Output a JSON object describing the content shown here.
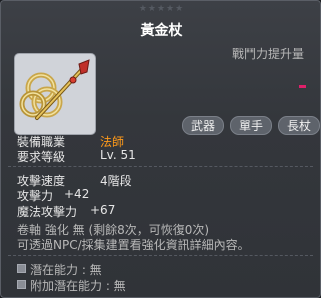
{
  "item": {
    "stars": "★★★★★",
    "name": "黃金杖",
    "power_label": "戰鬥力提升量",
    "tags": [
      "武器",
      "單手",
      "長杖"
    ],
    "job_label": "裝備職業",
    "job_value": "法師",
    "level_label": "要求等級",
    "level_value": "Lv. 51",
    "speed_label": "攻擊速度",
    "speed_value": "4階段",
    "attack_label": "攻擊力",
    "attack_value": "+42",
    "magic_label": "魔法攻擊力",
    "magic_value": "+67",
    "scroll_line": "卷軸 強化 無 (剩餘8次，可恢復0次)",
    "info_line": "可透過NPC/採集建置看強化資訊詳細內容。",
    "potential_label": "潛在能力 : 無",
    "bonus_potential_label": "附加潛在能力 : 無"
  },
  "colors": {
    "job_value": "#ff9a1a",
    "power_mark": "#e0206a"
  },
  "icons": {
    "item": "golden-staff-icon",
    "potential": "potential-square-icon"
  }
}
